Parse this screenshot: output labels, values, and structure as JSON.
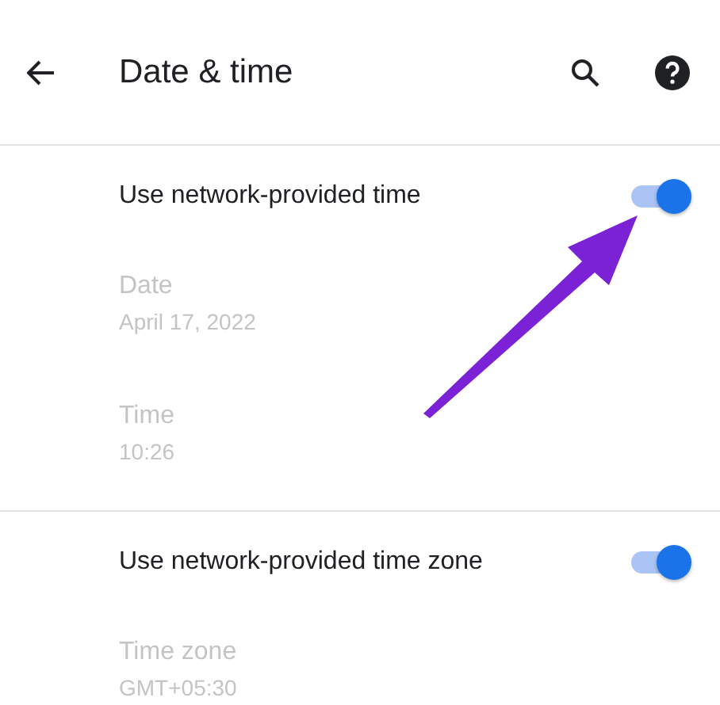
{
  "header": {
    "title": "Date & time"
  },
  "sections": [
    {
      "items": [
        {
          "kind": "switch",
          "title": "Use network-provided time",
          "on": true,
          "disabled": false
        },
        {
          "kind": "info",
          "title": "Date",
          "summary": "April 17, 2022",
          "disabled": true
        },
        {
          "kind": "info",
          "title": "Time",
          "summary": "10:26",
          "disabled": true
        }
      ]
    },
    {
      "items": [
        {
          "kind": "switch",
          "title": "Use network-provided time zone",
          "on": true,
          "disabled": false
        },
        {
          "kind": "info",
          "title": "Time zone",
          "summary": "GMT+05:30",
          "disabled": true
        }
      ]
    }
  ]
}
